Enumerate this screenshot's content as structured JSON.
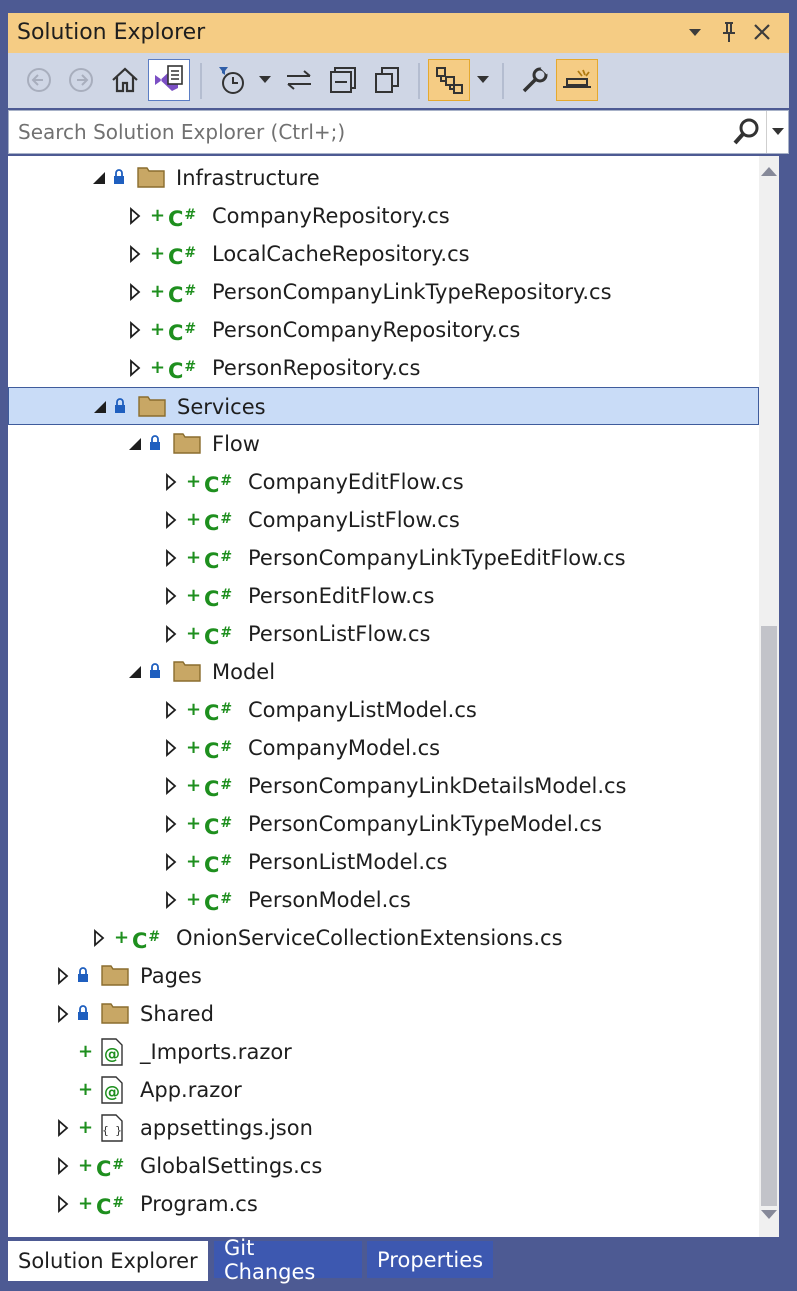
{
  "window": {
    "title": "Solution Explorer",
    "controls": [
      "dropdown-icon",
      "pin-icon",
      "close-icon"
    ]
  },
  "toolbar": {
    "buttons": [
      "back-icon",
      "forward-icon",
      "home-icon",
      "switch-views-icon",
      "pending-changes-filter-icon",
      "sync-icon",
      "collapse-all-icon",
      "show-all-files-icon",
      "track-active-item-icon",
      "properties-icon",
      "preview-selected-icon"
    ]
  },
  "search": {
    "placeholder": "Search Solution Explorer (Ctrl+;)"
  },
  "tree": {
    "cs_badge": "C",
    "cs_hash": "#",
    "razor_badge": "@",
    "json_badge": "{ }",
    "rows": [
      {
        "label": "Infrastructure",
        "type": "folder",
        "expanded": true
      },
      {
        "label": "CompanyRepository.cs",
        "type": "cs"
      },
      {
        "label": "LocalCacheRepository.cs",
        "type": "cs"
      },
      {
        "label": "PersonCompanyLinkTypeRepository.cs",
        "type": "cs"
      },
      {
        "label": "PersonCompanyRepository.cs",
        "type": "cs"
      },
      {
        "label": "PersonRepository.cs",
        "type": "cs"
      },
      {
        "label": "Services",
        "type": "folder",
        "expanded": true,
        "selected": true
      },
      {
        "label": "Flow",
        "type": "folder",
        "expanded": true
      },
      {
        "label": "CompanyEditFlow.cs",
        "type": "cs"
      },
      {
        "label": "CompanyListFlow.cs",
        "type": "cs"
      },
      {
        "label": "PersonCompanyLinkTypeEditFlow.cs",
        "type": "cs"
      },
      {
        "label": "PersonEditFlow.cs",
        "type": "cs"
      },
      {
        "label": "PersonListFlow.cs",
        "type": "cs"
      },
      {
        "label": "Model",
        "type": "folder",
        "expanded": true
      },
      {
        "label": "CompanyListModel.cs",
        "type": "cs"
      },
      {
        "label": "CompanyModel.cs",
        "type": "cs"
      },
      {
        "label": "PersonCompanyLinkDetailsModel.cs",
        "type": "cs"
      },
      {
        "label": "PersonCompanyLinkTypeModel.cs",
        "type": "cs"
      },
      {
        "label": "PersonListModel.cs",
        "type": "cs"
      },
      {
        "label": "PersonModel.cs",
        "type": "cs"
      },
      {
        "label": "OnionServiceCollectionExtensions.cs",
        "type": "cs"
      },
      {
        "label": "Pages",
        "type": "folder",
        "expanded": false
      },
      {
        "label": "Shared",
        "type": "folder",
        "expanded": false
      },
      {
        "label": "_Imports.razor",
        "type": "razor"
      },
      {
        "label": "App.razor",
        "type": "razor"
      },
      {
        "label": "appsettings.json",
        "type": "json"
      },
      {
        "label": "GlobalSettings.cs",
        "type": "cs"
      },
      {
        "label": "Program.cs",
        "type": "cs"
      }
    ]
  },
  "tabs": [
    {
      "label": "Solution Explorer",
      "active": true
    },
    {
      "label": "Git Changes",
      "active": false
    },
    {
      "label": "Properties",
      "active": false
    }
  ],
  "colors": {
    "title_bar": "#f5cc84",
    "toolbar": "#cfd6e5",
    "frame": "#4d5a93",
    "selection": "#c9dcf7",
    "csharp_green": "#1e8f1e",
    "folder": "#c8a765"
  }
}
